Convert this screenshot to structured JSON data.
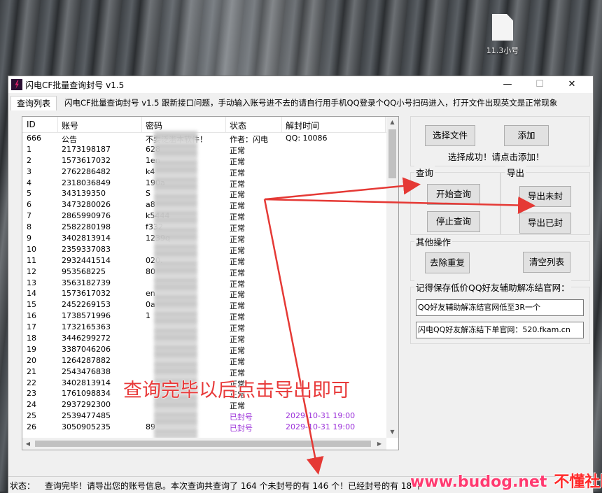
{
  "desktop": {
    "file_label": "11.3小号"
  },
  "window": {
    "title": "闪电CF批量查询封号 v1.5",
    "controls": {
      "minimize": "—",
      "maximize": "☐",
      "close": "✕"
    }
  },
  "tab": {
    "label": "查询列表"
  },
  "notice": "闪电CF批量查询封号 v1.5 跟新接口问题，手动输入账号进不去的请自行用手机QQ登录个QQ小号扫码进入，打开文件出现英文是正常现象",
  "list": {
    "columns": [
      "ID",
      "账号",
      "密码",
      "状态",
      "解封时间"
    ],
    "rows": [
      {
        "id": "666",
        "acct": "公告",
        "pw": "不要泛滥本软件！",
        "st": "作者：闪电",
        "tm": "QQ: 10086"
      },
      {
        "id": "1",
        "acct": "2173198187",
        "pw": "628",
        "st": "正常",
        "tm": ""
      },
      {
        "id": "2",
        "acct": "1573617032",
        "pw": "1en",
        "st": "正常",
        "tm": ""
      },
      {
        "id": "3",
        "acct": "2762286482",
        "pw": "k4",
        "st": "正常",
        "tm": ""
      },
      {
        "id": "4",
        "acct": "2318036849",
        "pw": "190a",
        "st": "正常",
        "tm": ""
      },
      {
        "id": "5",
        "acct": "343139350",
        "pw": "S",
        "st": "正常",
        "tm": ""
      },
      {
        "id": "6",
        "acct": "3473280026",
        "pw": "a8",
        "st": "正常",
        "tm": ""
      },
      {
        "id": "7",
        "acct": "2865990976",
        "pw": "k5444",
        "st": "正常",
        "tm": ""
      },
      {
        "id": "8",
        "acct": "2582280198",
        "pw": "f332",
        "st": "正常",
        "tm": ""
      },
      {
        "id": "9",
        "acct": "3402813914",
        "pw": "1239q",
        "st": "正常",
        "tm": ""
      },
      {
        "id": "10",
        "acct": "2359337083",
        "pw": "",
        "st": "正常",
        "tm": ""
      },
      {
        "id": "11",
        "acct": "2932441514",
        "pw": "020.",
        "st": "正常",
        "tm": ""
      },
      {
        "id": "12",
        "acct": "953568225",
        "pw": "80",
        "st": "正常",
        "tm": ""
      },
      {
        "id": "13",
        "acct": "3563182739",
        "pw": "",
        "st": "正常",
        "tm": ""
      },
      {
        "id": "14",
        "acct": "1573617032",
        "pw": "en",
        "st": "正常",
        "tm": ""
      },
      {
        "id": "15",
        "acct": "2452269153",
        "pw": "0a",
        "st": "正常",
        "tm": ""
      },
      {
        "id": "16",
        "acct": "1738571996",
        "pw": "1",
        "st": "正常",
        "tm": ""
      },
      {
        "id": "17",
        "acct": "1732165363",
        "pw": "",
        "st": "正常",
        "tm": ""
      },
      {
        "id": "18",
        "acct": "3446299272",
        "pw": "",
        "st": "正常",
        "tm": ""
      },
      {
        "id": "19",
        "acct": "3387046206",
        "pw": "",
        "st": "正常",
        "tm": ""
      },
      {
        "id": "20",
        "acct": "1264287882",
        "pw": "",
        "st": "正常",
        "tm": ""
      },
      {
        "id": "21",
        "acct": "2543476838",
        "pw": "",
        "st": "正常",
        "tm": ""
      },
      {
        "id": "22",
        "acct": "3402813914",
        "pw": "",
        "st": "正常",
        "tm": ""
      },
      {
        "id": "23",
        "acct": "1761098834",
        "pw": "",
        "st": "正常",
        "tm": ""
      },
      {
        "id": "24",
        "acct": "2937292300",
        "pw": "",
        "st": "正常",
        "tm": ""
      },
      {
        "id": "25",
        "acct": "2539477485",
        "pw": "",
        "st": "已封号",
        "tm": "2029-10-31 19:00"
      },
      {
        "id": "26",
        "acct": "3050905235",
        "pw": "89",
        "st": "已封号",
        "tm": "2029-10-31 19:00"
      }
    ]
  },
  "panel": {
    "select_file": "选择文件",
    "add": "添加",
    "select_msg": "选择成功！请点击添加！",
    "query_group": "查询",
    "export_group": "导出",
    "start_query": "开始查询",
    "stop_query": "停止查询",
    "export_unbanned": "导出未封",
    "export_banned": "导出已封",
    "other_group": "其他操作",
    "dedupe": "去除重复",
    "clear_list": "清空列表",
    "remember_text": "记得保存低价QQ好友辅助解冻结官网：",
    "box1": "QQ好友辅助解冻结官网低至3R一个",
    "box2": "闪电QQ好友解冻结下单官网：520.fkam.cn"
  },
  "status": {
    "label": "状态：",
    "text": "查询完毕！请导出您的账号信息。本次查询共查询了 164 个未封号的有 146 个！已经封号的有 18 个"
  },
  "annotation": {
    "text": "查询完毕以后点击导出即可",
    "arrow_color": "#e53935"
  },
  "watermark": {
    "site": "www.budog.net",
    "name": "不懂社区"
  }
}
